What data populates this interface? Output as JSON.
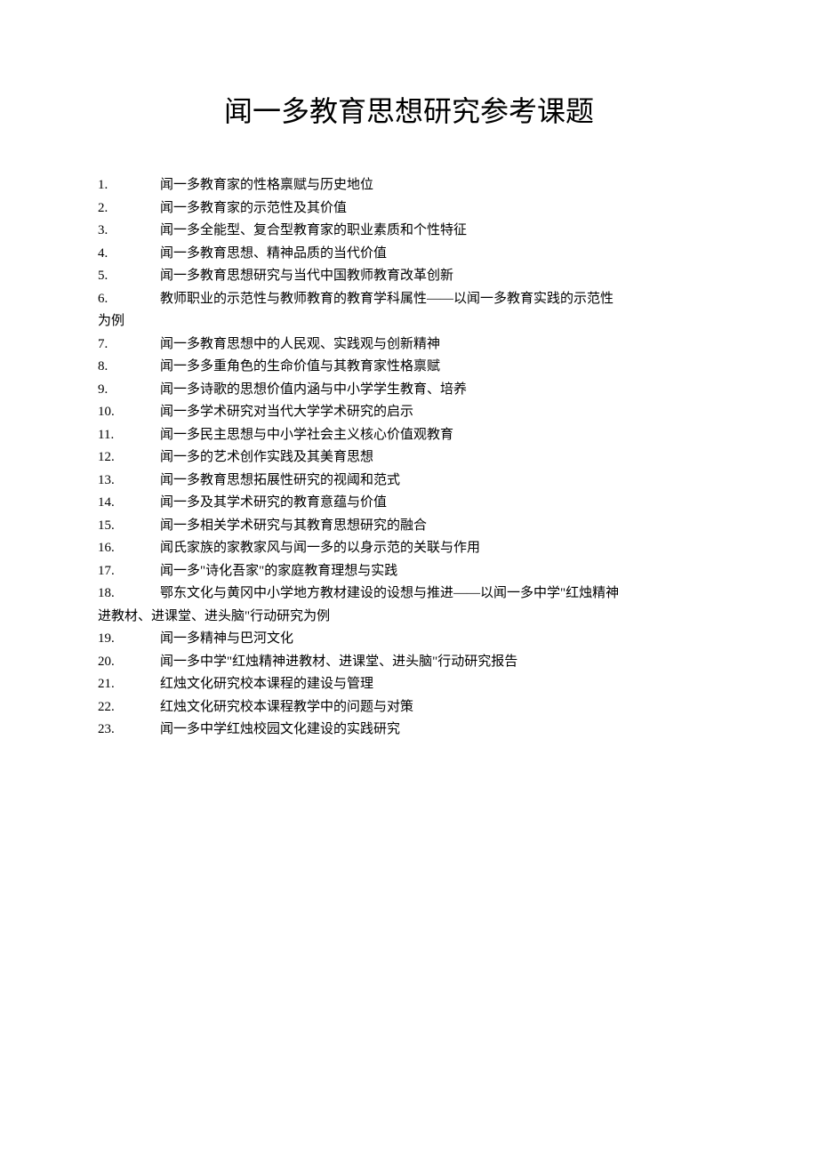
{
  "title": "闻一多教育思想研究参考课题",
  "items": [
    {
      "num": "1.",
      "text": "闻一多教育家的性格禀赋与历史地位"
    },
    {
      "num": "2.",
      "text": "闻一多教育家的示范性及其价值"
    },
    {
      "num": "3.",
      "text": "闻一多全能型、复合型教育家的职业素质和个性特征"
    },
    {
      "num": "4.",
      "text": "闻一多教育思想、精神品质的当代价值"
    },
    {
      "num": "5.",
      "text": "闻一多教育思想研究与当代中国教师教育改革创新"
    },
    {
      "num": "6.",
      "text": "教师职业的示范性与教师教育的教育学科属性——以闻一多教育实践的示范性",
      "cont": "为例"
    },
    {
      "num": "7.",
      "text": "闻一多教育思想中的人民观、实践观与创新精神"
    },
    {
      "num": "8.",
      "text": "闻一多多重角色的生命价值与其教育家性格禀赋"
    },
    {
      "num": "9.",
      "text": "闻一多诗歌的思想价值内涵与中小学学生教育、培养"
    },
    {
      "num": "10.",
      "text": "闻一多学术研究对当代大学学术研究的启示"
    },
    {
      "num": "11.",
      "text": "闻一多民主思想与中小学社会主义核心价值观教育"
    },
    {
      "num": "12.",
      "text": "闻一多的艺术创作实践及其美育思想"
    },
    {
      "num": "13.",
      "text": "闻一多教育思想拓展性研究的视阈和范式"
    },
    {
      "num": "14.",
      "text": "闻一多及其学术研究的教育意蕴与价值"
    },
    {
      "num": "15.",
      "text": "闻一多相关学术研究与其教育思想研究的融合"
    },
    {
      "num": "16.",
      "text": "闻氏家族的家教家风与闻一多的以身示范的关联与作用"
    },
    {
      "num": "17.",
      "text": "闻一多\"诗化吾家\"的家庭教育理想与实践"
    },
    {
      "num": "18.",
      "text": "鄂东文化与黄冈中小学地方教材建设的设想与推进——以闻一多中学\"红烛精神",
      "cont": "进教材、进课堂、进头脑\"行动研究为例"
    },
    {
      "num": "19.",
      "text": "闻一多精神与巴河文化"
    },
    {
      "num": "20.",
      "text": "闻一多中学\"红烛精神进教材、进课堂、进头脑\"行动研究报告"
    },
    {
      "num": "21.",
      "text": "红烛文化研究校本课程的建设与管理"
    },
    {
      "num": "22.",
      "text": "红烛文化研究校本课程教学中的问题与对策"
    },
    {
      "num": "23.",
      "text": "闻一多中学红烛校园文化建设的实践研究"
    }
  ]
}
